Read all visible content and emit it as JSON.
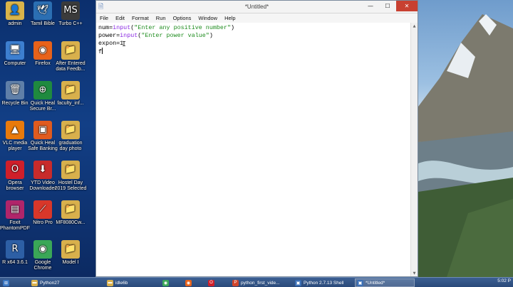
{
  "desktop": {
    "icons": [
      {
        "label": "admin",
        "color": "#d9b44a",
        "glyph": "👤"
      },
      {
        "label": "Tamil Bible",
        "color": "#2b6fb3",
        "glyph": "🕊"
      },
      {
        "label": "Turbo C++",
        "color": "#3b3b3b",
        "glyph": "MS"
      },
      {
        "label": "Computer",
        "color": "#3d7fd0",
        "glyph": "🖥"
      },
      {
        "label": "Firefox",
        "color": "#e8621a",
        "glyph": "◉"
      },
      {
        "label": "After Entered data Feedb...",
        "color": "#d8b04c",
        "glyph": "📁"
      },
      {
        "label": "Recycle Bin",
        "color": "#5f7fa8",
        "glyph": "🗑"
      },
      {
        "label": "Quick Heal Secure Br...",
        "color": "#1f8a3f",
        "glyph": "⊕"
      },
      {
        "label": "faculty_inf...",
        "color": "#d8b04c",
        "glyph": "📁"
      },
      {
        "label": "VLC media player",
        "color": "#e87a0c",
        "glyph": "▲"
      },
      {
        "label": "Quick Heal Safe Banking",
        "color": "#e05b1f",
        "glyph": "▣"
      },
      {
        "label": "graduation day photo",
        "color": "#d8b04c",
        "glyph": "📁"
      },
      {
        "label": "Opera browser",
        "color": "#cf1f2a",
        "glyph": "O"
      },
      {
        "label": "YTD Video Downloader",
        "color": "#c82b2b",
        "glyph": "⬇"
      },
      {
        "label": "Hostel Day 2019 Selected",
        "color": "#d8b04c",
        "glyph": "📁"
      },
      {
        "label": "Foxit PhantomPDF",
        "color": "#b0256a",
        "glyph": "▤"
      },
      {
        "label": "Nitro Pro",
        "color": "#d8372a",
        "glyph": "⟋"
      },
      {
        "label": "MF8080Cw...",
        "color": "#d8b04c",
        "glyph": "📁"
      },
      {
        "label": "R x64 3.6.1",
        "color": "#2d5fa5",
        "glyph": "R"
      },
      {
        "label": "Google Chrome",
        "color": "#3aa757",
        "glyph": "◉"
      },
      {
        "label": "Model I",
        "color": "#d8b04c",
        "glyph": "📁"
      }
    ]
  },
  "window": {
    "title": "*Untitled*",
    "buttons": {
      "minimize": "—",
      "maximize": "☐",
      "close": "✕"
    },
    "menu": [
      "File",
      "Edit",
      "Format",
      "Run",
      "Options",
      "Window",
      "Help"
    ]
  },
  "editor": {
    "line1": {
      "a": "num=",
      "fn": "input",
      "b": "(",
      "str": "\"Enter any positive number\"",
      "c": ")"
    },
    "line2": {
      "a": "power=",
      "fn": "input",
      "b": "(",
      "str": "\"Enter power value\"",
      "c": ")"
    },
    "line3": "expon=1",
    "line4": "f"
  },
  "taskbar": {
    "items": [
      {
        "label": "",
        "color": "#3b78c4",
        "glyph": "⊞"
      },
      {
        "label": "Python27",
        "color": "#d8b04c",
        "glyph": "▬"
      },
      {
        "label": "idle6b",
        "color": "#d8b04c",
        "glyph": "▬"
      },
      {
        "label": "",
        "color": "#3aa757",
        "glyph": "◉"
      },
      {
        "label": "",
        "color": "#e8621a",
        "glyph": "◉"
      },
      {
        "label": "",
        "color": "#cf1f2a",
        "glyph": "O"
      },
      {
        "label": "python_first_vide...",
        "color": "#d0452b",
        "glyph": "P"
      },
      {
        "label": "Python 2.7.13 Shell",
        "color": "#3b6fb5",
        "glyph": "▣"
      },
      {
        "label": "*Untitled*",
        "color": "#3b6fb5",
        "glyph": "▣"
      }
    ],
    "clock_time": "5:02 P"
  },
  "colors": {
    "string": "#1e8c1e",
    "builtin": "#8a2be2"
  }
}
